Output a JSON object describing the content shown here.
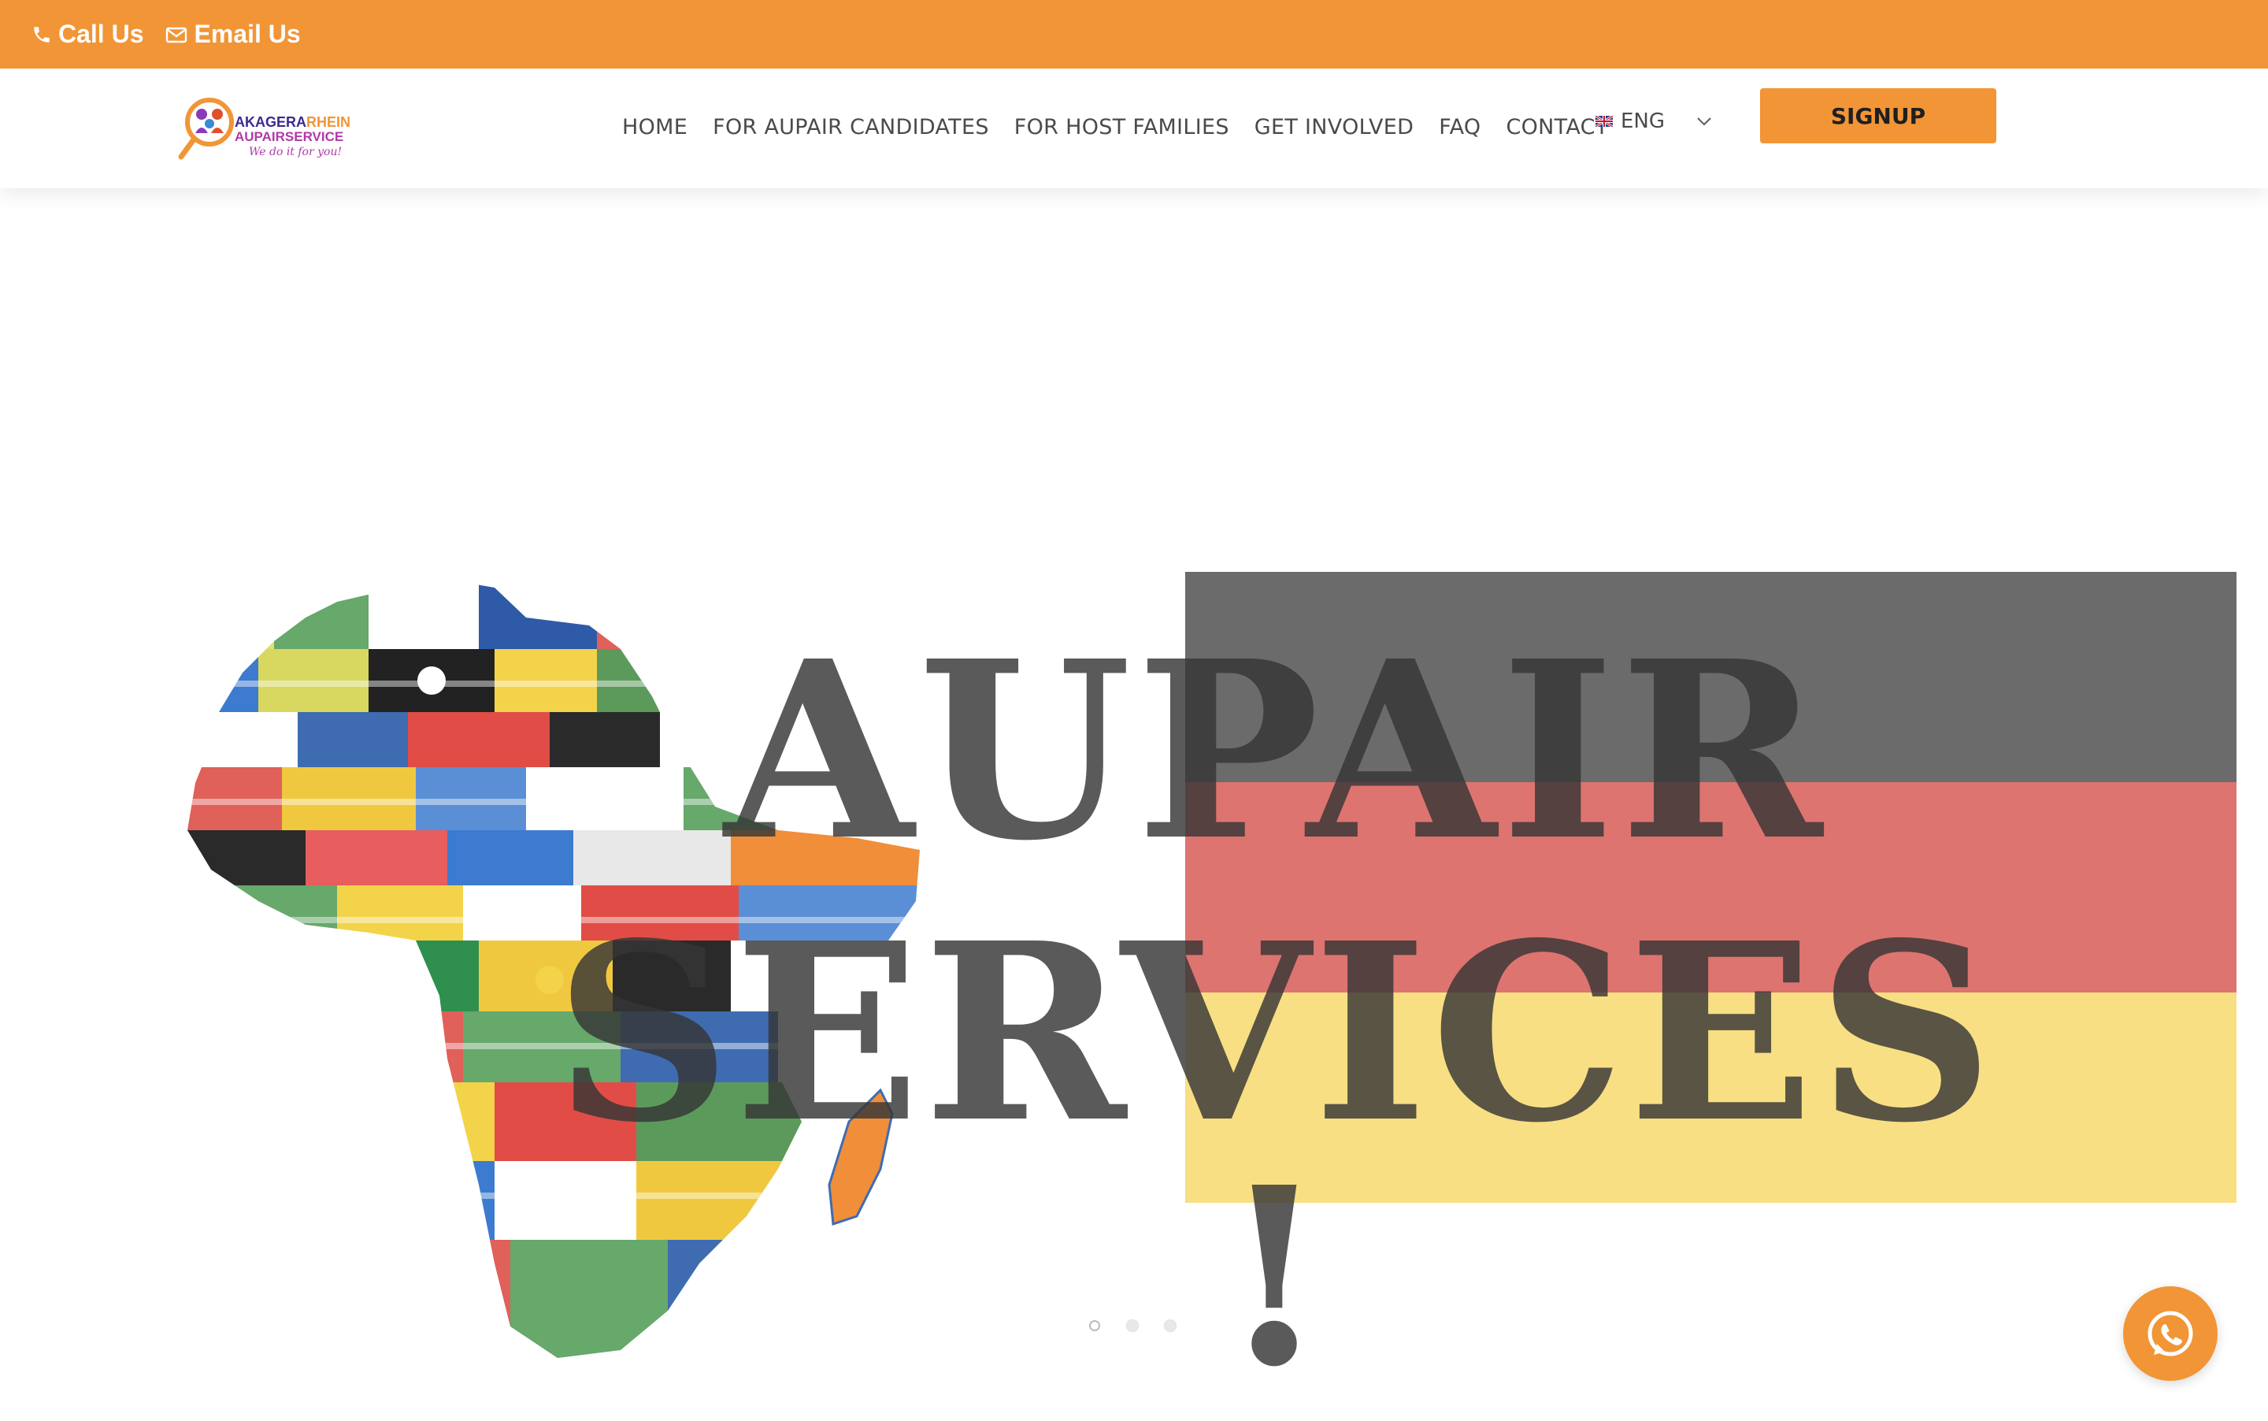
{
  "topbar": {
    "call_label": "Call Us",
    "email_label": "Email Us"
  },
  "logo": {
    "line1": "AKAGERARHEIN",
    "line2": "AUPAIRSERVICE",
    "tagline": "We do it for you!"
  },
  "nav": {
    "items": [
      {
        "label": "HOME"
      },
      {
        "label": "FOR AUPAIR CANDIDATES"
      },
      {
        "label": "FOR HOST FAMILIES"
      },
      {
        "label": "GET INVOLVED"
      },
      {
        "label": "FAQ"
      },
      {
        "label": "CONTACT"
      }
    ]
  },
  "language": {
    "selected": "ENG"
  },
  "signup_label": "SIGNUP",
  "hero": {
    "title_line1": "AUPAIR",
    "title_line2": "SERVICES !",
    "slides": 3,
    "active_slide": 1
  },
  "colors": {
    "accent": "#f29536",
    "nav_text": "#4a4a4a",
    "flag_black": "#6b6b6b",
    "flag_red": "#dd7470",
    "flag_gold": "#f8df83"
  }
}
